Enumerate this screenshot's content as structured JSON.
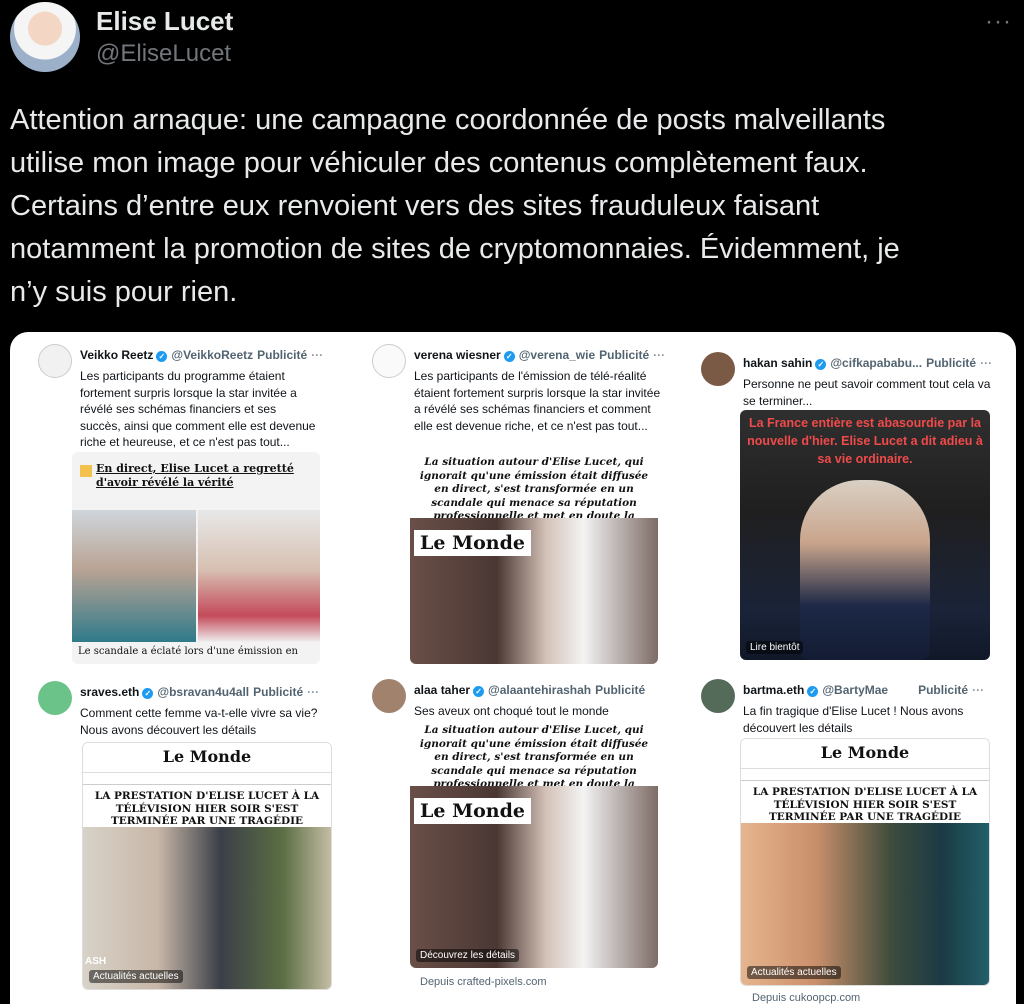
{
  "author": {
    "name": "Elise Lucet",
    "handle": "@EliseLucet",
    "more": "···"
  },
  "tweet": {
    "lines": [
      "Attention arnaque: une campagne coordonnée de posts malveillants",
      "utilise mon image pour véhiculer des contenus complètement faux.",
      "Certains d’entre eux renvoient vers des sites frauduleux faisant",
      "notamment la promotion de sites de cryptomonnaies. Évidemment, je",
      "n’y suis pour rien."
    ]
  },
  "cards": [
    {
      "name": "Veikko Reetz",
      "handle": "@VeikkoReetz",
      "pub": "Publicité",
      "dots": "···",
      "text": "Les participants du programme étaient fortement surpris lorsque la star invitée a révélé ses schémas financiers et ses succès, ainsi que comment elle est devenue riche et heureuse, et ce n'est pas tout...",
      "headline": "En direct, Elise Lucet a regretté d'avoir révélé la vérité",
      "footer": "Le scandale a éclaté lors d'une émission en"
    },
    {
      "name": "verena wiesner",
      "handle": "@verena_wie",
      "pub": "Publicité",
      "dots": "···",
      "text": "Les participants de l'émission de télé-réalité étaient fortement surpris lorsque la star invitée a révélé ses schémas financiers et comment elle est devenue riche, et ce n'est pas tout...",
      "headline": "La situation autour d'Elise Lucet, qui ignorait qu'une émission était diffusée en direct, s'est transformée en un scandale qui menace sa réputation professionnelle et met en doute la poursuite de sa carrière.",
      "logo": "Le Monde"
    },
    {
      "name": "hakan sahin",
      "handle": "@cifkapababu...",
      "pub": "Publicité",
      "dots": "···",
      "text": "Personne ne peut savoir comment tout cela va se terminer...",
      "overlay": "La France entière est abasourdie par la nouvelle d'hier. Elise Lucet a dit adieu à sa vie ordinaire.",
      "caption": "Lire bientôt"
    },
    {
      "name": "sraves.eth",
      "handle": "@bsravan4u4all",
      "pub": "Publicité",
      "dots": "···",
      "text": "Comment cette femme va-t-elle vivre sa vie? Nous avons découvert les détails",
      "logo": "Le Monde",
      "headline": "LA PRESTATION D'ELISE LUCET À LA TÉLÉVISION HIER SOIR S'EST TERMINÉE PAR UNE TRAGÉDIE",
      "caption": "Actualités actuelles",
      "tag": "ASH"
    },
    {
      "name": "alaa taher",
      "handle": "@alaantehirashah",
      "pub": "Publicité",
      "dots": "···",
      "text": "Ses aveux ont choqué tout le monde",
      "headline": "La situation autour d'Elise Lucet, qui ignorait qu'une émission était diffusée en direct, s'est transformée en un scandale qui menace sa réputation professionnelle et met en doute la poursuite de sa carrière.",
      "logo": "Le Monde",
      "caption": "Découvrez les détails",
      "source": "Depuis crafted-pixels.com"
    },
    {
      "name": "bartma.eth",
      "handle": "@BartyMae",
      "pub": "Publicité",
      "dots": "···",
      "text": "La fin tragique d'Elise Lucet ! Nous avons découvert les détails",
      "logo": "Le Monde",
      "headline": "LA PRESTATION D'ELISE LUCET À LA TÉLÉVISION HIER SOIR S'EST TERMINÉE PAR UNE TRAGÉDIE",
      "caption": "Actualités actuelles",
      "source": "Depuis cukoopcp.com"
    }
  ],
  "colors": {
    "background": "#000000",
    "verified": "#1d9bf0",
    "overlay_text": "#f04a4a"
  }
}
